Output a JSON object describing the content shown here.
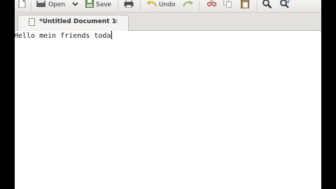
{
  "toolbar": {
    "open_label": "Open",
    "save_label": "Save",
    "undo_label": "Undo"
  },
  "tab": {
    "title": "*Untitled Document 1",
    "close_glyph": "×"
  },
  "editor": {
    "text": "Hello mein friends toda"
  },
  "icons": {
    "new": "document-new-icon",
    "open": "folder-open-icon",
    "dropdown": "chevron-down-icon",
    "save": "save-icon",
    "print": "print-icon",
    "undo": "undo-icon",
    "redo": "redo-icon",
    "cut": "cut-icon",
    "copy": "copy-icon",
    "paste": "paste-icon",
    "find": "search-icon",
    "replace": "find-replace-icon"
  },
  "colors": {
    "background": "#000000",
    "window": "#ffffff",
    "toolbar": "#ecebe8",
    "undo_arrow": "#d9b531",
    "redo_arrow": "#9bbf74",
    "cut_red": "#c84a4a"
  }
}
